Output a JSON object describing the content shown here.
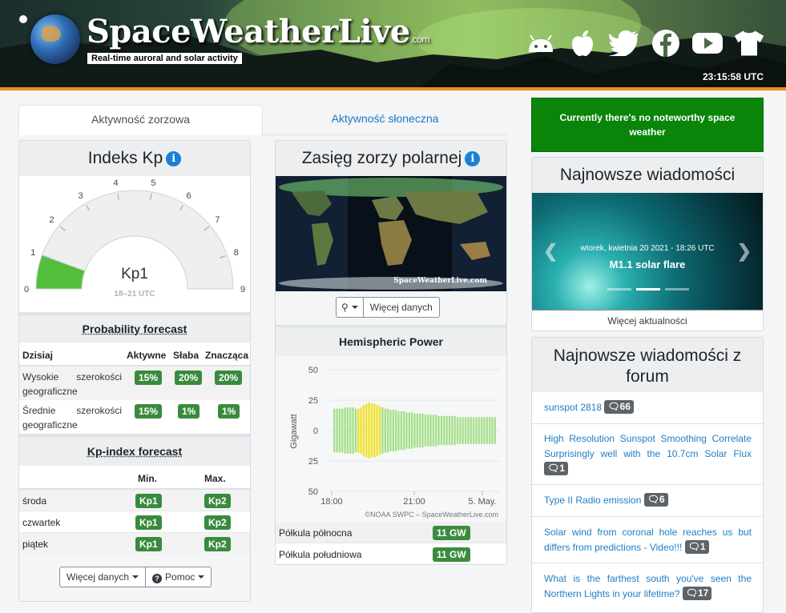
{
  "header": {
    "title": "SpaceWeatherLive",
    "title_suffix": ".com",
    "tagline": "Real-time auroral and solar activity",
    "utc_time": "23:15:58 UTC",
    "social_icons": [
      "android-icon",
      "apple-icon",
      "twitter-icon",
      "facebook-icon",
      "youtube-icon",
      "tshirt-icon"
    ]
  },
  "tabs": [
    {
      "label": "Aktywność zorzowa",
      "active": true
    },
    {
      "label": "Aktywność słoneczna",
      "active": false
    }
  ],
  "kp_card": {
    "title": "Indeks Kp",
    "gauge_value_label": "Kp1",
    "gauge_time": "18–21 UTC",
    "gauge_value": 1,
    "gauge_ticks": [
      "0",
      "1",
      "2",
      "3",
      "4",
      "5",
      "6",
      "7",
      "8",
      "9"
    ],
    "probability": {
      "title": "Probability forecast",
      "headers": [
        "Dzisiaj",
        "Aktywne",
        "Słaba",
        "Znacząca"
      ],
      "rows": [
        {
          "label": "Wysokie szerokości geograficzne",
          "values": [
            "15%",
            "20%",
            "20%"
          ]
        },
        {
          "label": "Średnie szerokości geograficzne",
          "values": [
            "15%",
            "1%",
            "1%"
          ]
        }
      ]
    },
    "kp_forecast": {
      "title": "Kp-index forecast",
      "headers": [
        "",
        "Min.",
        "Max."
      ],
      "rows": [
        {
          "day": "środa",
          "min": "Kp1",
          "max": "Kp2"
        },
        {
          "day": "czwartek",
          "min": "Kp1",
          "max": "Kp2"
        },
        {
          "day": "piątek",
          "min": "Kp1",
          "max": "Kp2"
        }
      ]
    },
    "more_data_label": "Więcej danych",
    "help_label": "Pomoc"
  },
  "aurora_card": {
    "title": "Zasięg zorzy polarnej",
    "map_watermark": "SpaceWeatherLive.com",
    "more_data_label": "Więcej danych",
    "hp_title": "Hemispheric Power",
    "hp_credit": "©NOAA SWPC – SpaceWeatherLive.com",
    "north_label": "Półkula północna",
    "north_value": "11 GW",
    "south_label": "Półkula południowa",
    "south_value": "11 GW"
  },
  "chart_data": {
    "type": "bar",
    "ylabel": "Gigawatt",
    "yticks": [
      "50",
      "25",
      "0",
      "25",
      "50"
    ],
    "xticks": [
      "18:00",
      "21:00",
      "5. May."
    ],
    "ylim": [
      -50,
      50
    ],
    "series": [
      {
        "name": "north",
        "color": "#a6e08a",
        "values": [
          18,
          18,
          18,
          18,
          19,
          19,
          19,
          19,
          18,
          18,
          19,
          21,
          22,
          23,
          22,
          22,
          21,
          20,
          19,
          18,
          18,
          17,
          17,
          17,
          16,
          16,
          16,
          15,
          15,
          15,
          14,
          14,
          14,
          14,
          13,
          13,
          13,
          13,
          13,
          12,
          12,
          12,
          12,
          12,
          12,
          12,
          11,
          11,
          11,
          11,
          11,
          11,
          11,
          11,
          11,
          11,
          11,
          11,
          11,
          11,
          11
        ]
      },
      {
        "name": "south",
        "color": "#a6e08a",
        "values": [
          -18,
          -18,
          -18,
          -18,
          -19,
          -19,
          -19,
          -19,
          -18,
          -18,
          -19,
          -21,
          -22,
          -23,
          -22,
          -22,
          -21,
          -20,
          -19,
          -18,
          -18,
          -17,
          -17,
          -17,
          -16,
          -16,
          -16,
          -15,
          -15,
          -15,
          -14,
          -14,
          -14,
          -14,
          -13,
          -13,
          -13,
          -13,
          -13,
          -12,
          -12,
          -12,
          -12,
          -12,
          -12,
          -12,
          -11,
          -11,
          -11,
          -11,
          -11,
          -11,
          -11,
          -11,
          -11,
          -11,
          -11,
          -11,
          -11,
          -11,
          -11
        ]
      }
    ],
    "highlight_color": "#f0e02a",
    "highlight_range": [
      9,
      17
    ]
  },
  "right": {
    "alert_text": "Currently there's no noteworthy space weather",
    "news_title": "Najnowsze wiadomości",
    "news_slide_date": "wtorek, kwietnia 20 2021 - 18:26 UTC",
    "news_slide_title": "M1.1 solar flare",
    "more_news_label": "Więcej aktualności",
    "forum_title": "Najnowsze wiadomości z forum",
    "forum_items": [
      {
        "text": "sunspot 2818",
        "count": "66"
      },
      {
        "text": "High Resolution Sunspot Smoothing Correlate Surprisingly well with the 10.7cm Solar Flux",
        "count": "1"
      },
      {
        "text": "Type II Radio emission",
        "count": "6"
      },
      {
        "text": "Solar wind from coronal hole reaches us but differs from predictions - Video!!!",
        "count": "1"
      },
      {
        "text": "What is the farthest south you've seen the Northern Lights in your lifetime?",
        "count": "17"
      }
    ]
  }
}
